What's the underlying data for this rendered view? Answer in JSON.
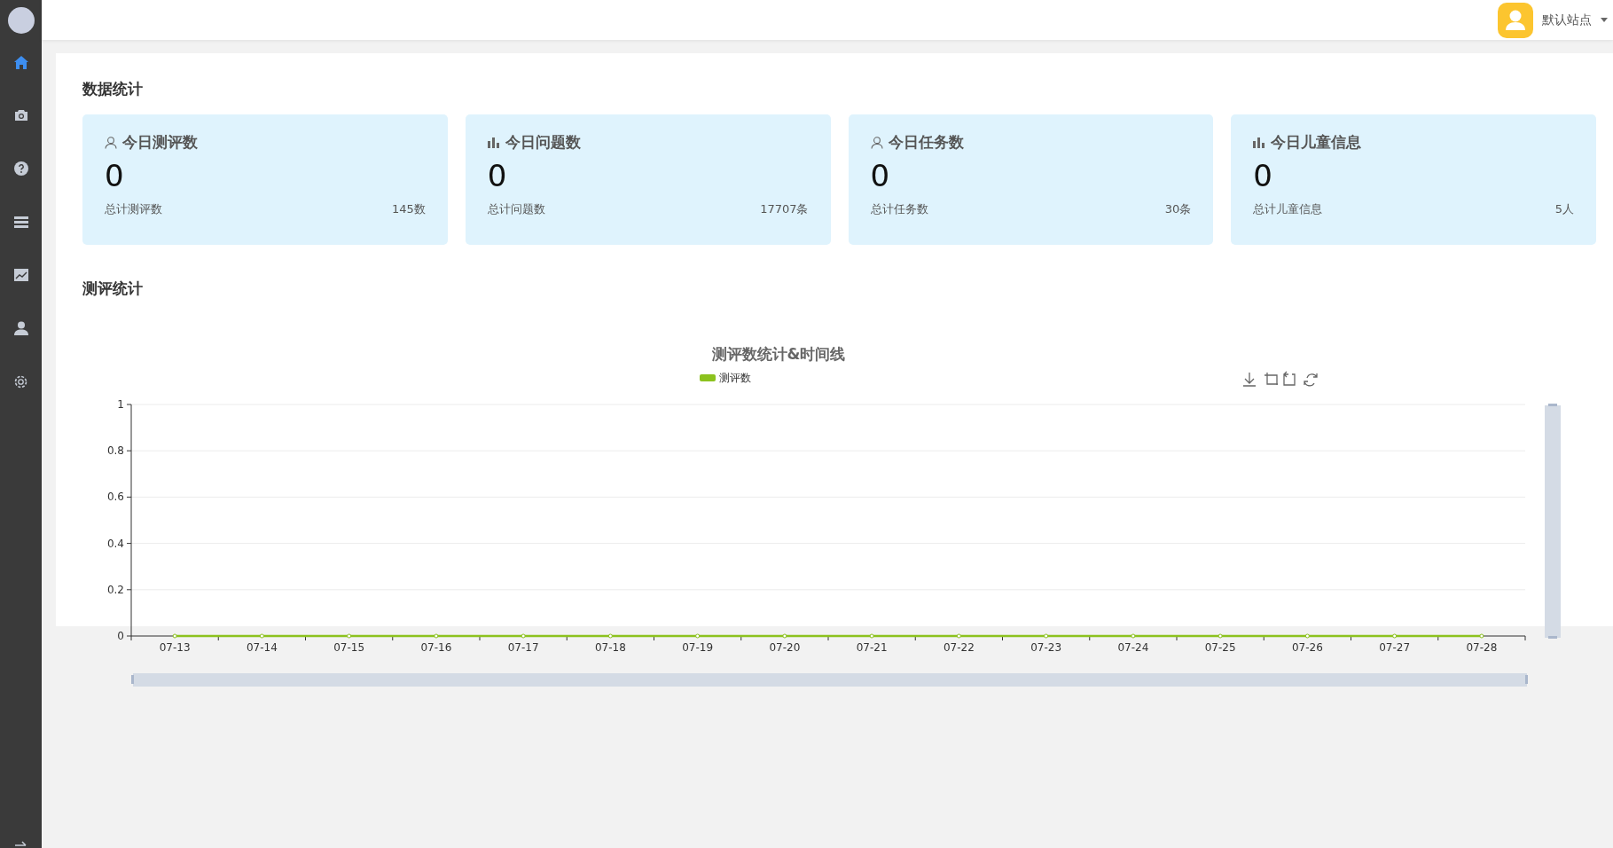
{
  "sidebar": {
    "items": [
      {
        "kind": "home",
        "selected": true
      },
      {
        "kind": "camera",
        "selected": false
      },
      {
        "kind": "question",
        "selected": false
      },
      {
        "kind": "list",
        "selected": false
      },
      {
        "kind": "chart",
        "selected": false
      },
      {
        "kind": "user",
        "selected": false
      },
      {
        "kind": "gear",
        "selected": false
      }
    ]
  },
  "header": {
    "site_name": "默认站点"
  },
  "stats": {
    "title": "数据统计",
    "cards": [
      {
        "kind": "person",
        "title": "今日测评数",
        "value": "0",
        "total_label": "总计测评数",
        "total": "145数"
      },
      {
        "kind": "bars",
        "title": "今日问题数",
        "value": "0",
        "total_label": "总计问题数",
        "total": "17707条"
      },
      {
        "kind": "person",
        "title": "今日任务数",
        "value": "0",
        "total_label": "总计任务数",
        "total": "30条"
      },
      {
        "kind": "bars",
        "title": "今日儿童信息",
        "value": "0",
        "total_label": "总计儿童信息",
        "total": "5人"
      }
    ]
  },
  "evaluation": {
    "title": "测评统计",
    "chart_data": {
      "type": "line",
      "title": "测评数统计&时间线",
      "categories": [
        "07-13",
        "07-14",
        "07-15",
        "07-16",
        "07-17",
        "07-18",
        "07-19",
        "07-20",
        "07-21",
        "07-22",
        "07-23",
        "07-24",
        "07-25",
        "07-26",
        "07-27",
        "07-28"
      ],
      "series": [
        {
          "name": "测评数",
          "color": "#8cc21e",
          "marker": true,
          "values": [
            0,
            0,
            0,
            0,
            0,
            0,
            0,
            0,
            0,
            0,
            0,
            0,
            0,
            0,
            0,
            0
          ]
        }
      ],
      "grid": true,
      "ylim": [
        0,
        1
      ],
      "yticks": [
        0,
        0.2,
        0.4,
        0.6,
        0.8,
        1
      ]
    }
  }
}
